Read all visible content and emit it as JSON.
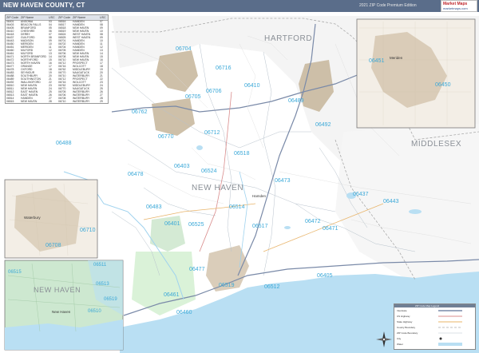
{
  "header": {
    "title": "NEW HAVEN COUNTY, CT",
    "edition": "2021 ZIP Code Premium Edition",
    "logo_top": "Market Maps",
    "logo_bottom": "marketmaps.com"
  },
  "regions": [
    {
      "name": "county-label-hartford",
      "text": "HARTFORD"
    },
    {
      "name": "county-label-middlesex",
      "text": "MIDDLESEX"
    },
    {
      "name": "county-label-new-haven",
      "text": "NEW HAVEN"
    },
    {
      "name": "inset-label-new-haven",
      "text": "NEW HAVEN"
    }
  ],
  "zip_labels": [
    {
      "id": "z1",
      "text": "06704"
    },
    {
      "id": "z2",
      "text": "06716"
    },
    {
      "id": "z3",
      "text": "06410"
    },
    {
      "id": "z4",
      "text": "06451"
    },
    {
      "id": "z5",
      "text": "06450"
    },
    {
      "id": "z6",
      "text": "06706"
    },
    {
      "id": "z7",
      "text": "06705"
    },
    {
      "id": "z8",
      "text": "06489"
    },
    {
      "id": "z9",
      "text": "06762"
    },
    {
      "id": "z10",
      "text": "06492"
    },
    {
      "id": "z11",
      "text": "06770"
    },
    {
      "id": "z12",
      "text": "06712"
    },
    {
      "id": "z13",
      "text": "06488"
    },
    {
      "id": "z14",
      "text": "06518"
    },
    {
      "id": "z15",
      "text": "06478"
    },
    {
      "id": "z16",
      "text": "06403"
    },
    {
      "id": "z17",
      "text": "06524"
    },
    {
      "id": "z18",
      "text": "06473"
    },
    {
      "id": "z19",
      "text": "06437"
    },
    {
      "id": "z20",
      "text": "06443"
    },
    {
      "id": "z21",
      "text": "06483"
    },
    {
      "id": "z22",
      "text": "06514"
    },
    {
      "id": "z23",
      "text": "06401"
    },
    {
      "id": "z24",
      "text": "06525"
    },
    {
      "id": "z25",
      "text": "06517"
    },
    {
      "id": "z26",
      "text": "06472"
    },
    {
      "id": "z27",
      "text": "06471"
    },
    {
      "id": "z28",
      "text": "06477"
    },
    {
      "id": "z29",
      "text": "06405"
    },
    {
      "id": "z30",
      "text": "06519"
    },
    {
      "id": "z31",
      "text": "06512"
    },
    {
      "id": "z32",
      "text": "06461"
    },
    {
      "id": "z33",
      "text": "06460"
    },
    {
      "id": "z34",
      "text": "06708"
    },
    {
      "id": "z35",
      "text": "06710"
    },
    {
      "id": "z36",
      "text": "06511"
    },
    {
      "id": "z37",
      "text": "06515"
    },
    {
      "id": "z38",
      "text": "06513"
    },
    {
      "id": "z39",
      "text": "06510"
    },
    {
      "id": "z40",
      "text": "06519"
    }
  ],
  "place_labels": [
    {
      "id": "p1",
      "text": "Meriden"
    },
    {
      "id": "p2",
      "text": "Waterbury"
    },
    {
      "id": "p3",
      "text": "New Haven"
    },
    {
      "id": "p4",
      "text": "Hamden"
    }
  ],
  "zip_table": {
    "headers": [
      "ZIP Code",
      "ZIP Name",
      "USC",
      "ZIP Code",
      "ZIP Name",
      "USC"
    ],
    "rows": [
      [
        "06401",
        "ANSONIA",
        "03",
        "06516",
        "HAMDEN",
        "07"
      ],
      [
        "06403",
        "BEACON FALLS",
        "04",
        "06517",
        "HAMDEN",
        "08"
      ],
      [
        "06405",
        "BRANFORD",
        "05",
        "06518",
        "NEW HAVEN",
        "09"
      ],
      [
        "06410",
        "CHESHIRE",
        "06",
        "06519",
        "NEW HAVEN",
        "10"
      ],
      [
        "06418",
        "DERBY",
        "07",
        "06524",
        "WEST HAVEN",
        "08"
      ],
      [
        "06437",
        "GUILFORD",
        "08",
        "06525",
        "WEST HAVEN",
        "09"
      ],
      [
        "06443",
        "MADISON",
        "09",
        "06701",
        "HAMDEN",
        "10"
      ],
      [
        "06450",
        "MERIDEN",
        "10",
        "06702",
        "HAMDEN",
        "11"
      ],
      [
        "06451",
        "MERIDEN",
        "11",
        "06704",
        "HAMDEN",
        "12"
      ],
      [
        "06460",
        "MILFORD",
        "12",
        "06705",
        "HAMDEN",
        "13"
      ],
      [
        "06461",
        "MILFORD",
        "13",
        "06706",
        "NEW HAVEN",
        "14"
      ],
      [
        "06471",
        "NORTH BRANFORD",
        "14",
        "06708",
        "NEW HAVEN",
        "15"
      ],
      [
        "06472",
        "NORTHFORD",
        "15",
        "06710",
        "NEW HAVEN",
        "16"
      ],
      [
        "06473",
        "NORTH HAVEN",
        "16",
        "06712",
        "PROSPECT",
        "17"
      ],
      [
        "06477",
        "ORANGE",
        "17",
        "06716",
        "WOLCOTT",
        "18"
      ],
      [
        "06478",
        "OXFORD",
        "18",
        "06762",
        "MIDDLEBURY",
        "19"
      ],
      [
        "06483",
        "SEYMOUR",
        "19",
        "06770",
        "NAUGATUCK",
        "20"
      ],
      [
        "06488",
        "SOUTHBURY",
        "20",
        "06710",
        "WATERBURY",
        "21"
      ],
      [
        "06489",
        "SOUTHINGTON",
        "21",
        "06712",
        "PROSPECT",
        "22"
      ],
      [
        "06492",
        "WALLINGFORD",
        "22",
        "06716",
        "WOLCOTT",
        "23"
      ],
      [
        "06510",
        "NEW HAVEN",
        "23",
        "06762",
        "MIDDLEBURY",
        "24"
      ],
      [
        "06511",
        "NEW HAVEN",
        "24",
        "06770",
        "NAUGATUCK",
        "25"
      ],
      [
        "06512",
        "EAST HAVEN",
        "25",
        "06705",
        "WATERBURY",
        "26"
      ],
      [
        "06513",
        "EAST HAVEN",
        "26",
        "06706",
        "WATERBURY",
        "27"
      ],
      [
        "06514",
        "HAMDEN",
        "27",
        "06708",
        "WATERBURY",
        "28"
      ],
      [
        "06515",
        "NEW HAVEN",
        "28",
        "06710",
        "WATERBURY",
        "29"
      ]
    ]
  },
  "legend": {
    "title": "ZIP Code Map Legend",
    "items": [
      "Interstate",
      "US Highway",
      "State Highway",
      "County Boundary",
      "ZIP Code Boundary",
      "City",
      "Water"
    ]
  },
  "colors": {
    "header_bg": "#5a6d8a",
    "water": "#b9dff3",
    "urban": "#c8b8a0",
    "zip_label": "#3aa8d8",
    "county_label": "#8a8f96",
    "land": "#ffffff"
  }
}
